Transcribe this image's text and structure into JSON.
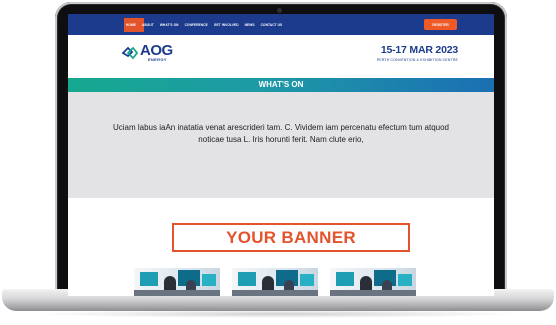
{
  "topnav": {
    "items": [
      "Home",
      "About",
      "What's On",
      "Conference",
      "Get Involved",
      "News",
      "Contact Us"
    ],
    "cta_label": "Register"
  },
  "header": {
    "logo_main": "AOG",
    "logo_sub": "ENERGY",
    "date": "15-17 MAR 2023",
    "venue": "Perth Convention & Exhibition Centre"
  },
  "section": {
    "heading": "WHAT'S ON",
    "body": "Uciam labus iaAn inatatia venat arescrideri tam. C. Vividem iam percenatu efectum tum atquod noticae tusa L. Iris horunti ferit. Nam clute erio,"
  },
  "banner": {
    "label": "YOUR BANNER"
  },
  "colors": {
    "brand_navy": "#1c3b8c",
    "accent_orange": "#e3532c",
    "teal": "#16a88f",
    "intro_bg": "#e3e3e5"
  }
}
